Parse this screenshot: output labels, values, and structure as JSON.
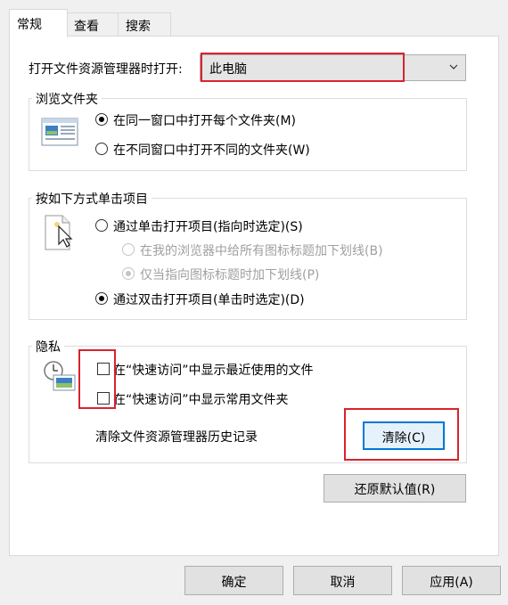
{
  "tabs": [
    {
      "label": "常规"
    },
    {
      "label": "查看"
    },
    {
      "label": "搜索"
    }
  ],
  "open_explorer": {
    "label": "打开文件资源管理器时打开:",
    "value": "此电脑"
  },
  "browse_folders": {
    "title": "浏览文件夹",
    "options": [
      {
        "label": "在同一窗口中打开每个文件夹(M)",
        "checked": true
      },
      {
        "label": "在不同窗口中打开不同的文件夹(W)",
        "checked": false
      }
    ]
  },
  "click_items": {
    "title": "按如下方式单击项目",
    "options": [
      {
        "label": "通过单击打开项目(指向时选定)(S)",
        "checked": false,
        "disabled": false
      },
      {
        "label": "在我的浏览器中给所有图标标题加下划线(B)",
        "checked": false,
        "disabled": true
      },
      {
        "label": "仅当指向图标标题时加下划线(P)",
        "checked": true,
        "disabled": true
      },
      {
        "label": "通过双击打开项目(单击时选定)(D)",
        "checked": true,
        "disabled": false
      }
    ]
  },
  "privacy": {
    "title": "隐私",
    "checkboxes": [
      {
        "label": "在“快速访问”中显示最近使用的文件",
        "checked": false
      },
      {
        "label": "在“快速访问”中显示常用文件夹",
        "checked": false
      }
    ],
    "clear_label": "清除文件资源管理器历史记录",
    "clear_button": "清除(C)"
  },
  "restore_defaults": "还原默认值(R)",
  "footer": {
    "ok": "确定",
    "cancel": "取消",
    "apply": "应用(A)"
  },
  "colors": {
    "highlight": "#d9232e",
    "focus": "#0078d7"
  }
}
